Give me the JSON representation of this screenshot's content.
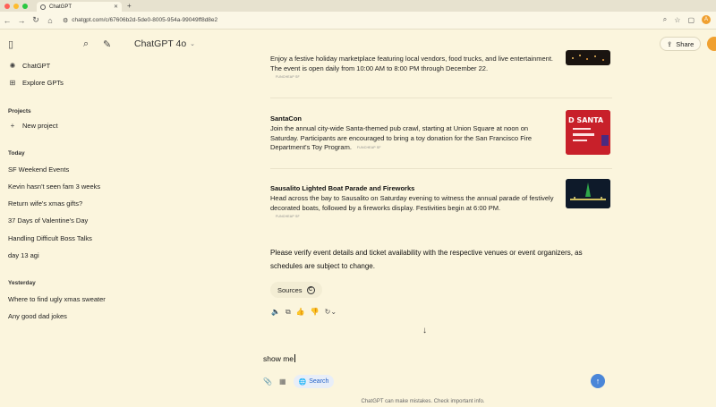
{
  "browser": {
    "tab_title": "ChatGPT",
    "url": "chatgpt.com/c/67606b2d-5de0-8005-954a-99049ff8d8e2",
    "profile_initial": "A",
    "window_dots": [
      "#ff5f57",
      "#febc2e",
      "#28c840"
    ]
  },
  "sidebar": {
    "items_top": [
      {
        "label": "ChatGPT",
        "icon": "chatgpt-logo-icon"
      },
      {
        "label": "Explore GPTs",
        "icon": "grid-icon"
      }
    ],
    "projects_heading": "Projects",
    "new_project": "New project",
    "today_heading": "Today",
    "today": [
      "SF Weekend Events",
      "Kevin hasn't seen fam 3 weeks",
      "Return wife's xmas gifts?",
      "37 Days of Valentine's Day",
      "Handling Difficult Boss Talks",
      "day 13 agi"
    ],
    "yesterday_heading": "Yesterday",
    "yesterday": [
      "Where to find ugly xmas sweater",
      "Any good dad jokes"
    ]
  },
  "header": {
    "model": "ChatGPT 4o",
    "share_label": "Share"
  },
  "events": [
    {
      "name": "",
      "desc": "Enjoy a festive holiday marketplace featuring local vendors, food trucks, and live entertainment. The event is open daily from 10:00 AM to 8:00 PM through December 22.",
      "source": "FUNCHEAP SF"
    },
    {
      "name": "SantaCon",
      "desc": "Join the annual city-wide Santa-themed pub crawl, starting at Union Square at noon on Saturday. Participants are encouraged to bring a toy donation for the San Francisco Fire Department's Toy Program.",
      "source": "FUNCHEAP SF",
      "thumb_text": "D SANTA"
    },
    {
      "name": "Sausalito Lighted Boat Parade and Fireworks",
      "desc": "Head across the bay to Sausalito on Saturday evening to witness the annual parade of festively decorated boats, followed by a fireworks display. Festivities begin at 6:00 PM.",
      "source": "FUNCHEAP SF"
    }
  ],
  "note": "Please verify event details and ticket availability with the respective venues or event organizers, as schedules are subject to change.",
  "sources_label": "Sources",
  "sources_badge": "C",
  "composer": {
    "text": "show me",
    "search_label": "Search"
  },
  "disclaimer": "ChatGPT can make mistakes. Check important info.",
  "colors": {
    "background": "#fbf5dd",
    "send": "#4a86d8",
    "search_pill": "#e8eef8"
  }
}
